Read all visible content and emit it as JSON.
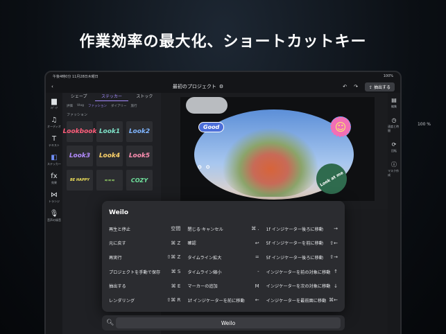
{
  "headline": "作業効率の最大化、ショートカットキー",
  "status": {
    "left": "午後4時0分 11月28日木曜日",
    "right": "100%"
  },
  "topbar": {
    "back": "‹",
    "title": "最初のプロジェクト",
    "export_label": "抽出する"
  },
  "left_tools": [
    {
      "name": "folder-icon",
      "icon": "▆",
      "label": "ﾒﾃﾞｨｱ"
    },
    {
      "name": "music-icon",
      "icon": "♫",
      "label": "オーディオ"
    },
    {
      "name": "text-icon",
      "icon": "T",
      "label": "テキスト"
    },
    {
      "name": "sticker-icon",
      "icon": "◧",
      "label": "ステッカー"
    },
    {
      "name": "fx-icon",
      "icon": "fx",
      "label": "効果"
    },
    {
      "name": "transition-icon",
      "icon": "⋈",
      "label": "トランジ"
    },
    {
      "name": "mic-icon",
      "icon": "🎙",
      "label": "音声の録音"
    }
  ],
  "panel": {
    "tabs": [
      "シェープ",
      "ステッカー",
      "ストック"
    ],
    "subtabs": [
      "評価",
      "Vlog",
      "ファッション",
      "ダイアリー",
      "旅行"
    ],
    "category": "ファッション",
    "stickers": [
      "Lookbook",
      "Look1",
      "Look2",
      "Look3",
      "Look4",
      "Look5",
      "BE HAPPY",
      "≈≈≈",
      "COZY"
    ]
  },
  "canvas": {
    "good": "Good",
    "look_at_me": "Look at me",
    "zoom": "100 %"
  },
  "right_tools": [
    "編集",
    "速度と時間",
    "回転",
    "マスク作成"
  ],
  "dialog": {
    "title": "Weilo",
    "columns": [
      [
        {
          "label": "再生と停止",
          "key": "空間"
        },
        {
          "label": "元に戻す",
          "key": "⌘ Z"
        },
        {
          "label": "再実行",
          "key": "⇧⌘ Z"
        },
        {
          "label": "プロジェクトを手動で保存",
          "key": "⌘ S"
        },
        {
          "label": "抽出する",
          "key": "⌘ E"
        },
        {
          "label": "レンダリング",
          "key": "⇧⌘ R"
        }
      ],
      [
        {
          "label": "閉じる·キャンセル",
          "key": "⌘ ."
        },
        {
          "label": "確認",
          "key": "↩"
        },
        {
          "label": "タイムライン拡大",
          "key": "="
        },
        {
          "label": "タイムライン縮小",
          "key": "-"
        },
        {
          "label": "マーカーの追加",
          "key": "M"
        },
        {
          "label": "1f インジケーターを前に移動",
          "key": "←"
        }
      ],
      [
        {
          "label": "1f インジケーター後ろに移動",
          "key": "→"
        },
        {
          "label": "5f インジケーターを前に移動",
          "key": "⇧←"
        },
        {
          "label": "5f インジケーター後ろに移動",
          "key": "⇧→"
        },
        {
          "label": "インジケーターを前の対象に移動",
          "key": "↑"
        },
        {
          "label": "インジケーターを次の対象に移動",
          "key": "↓"
        },
        {
          "label": "インジケーターを最前面に移動",
          "key": "⌘←"
        }
      ]
    ]
  },
  "search": {
    "icon": "search-icon",
    "value": "Weilo"
  }
}
